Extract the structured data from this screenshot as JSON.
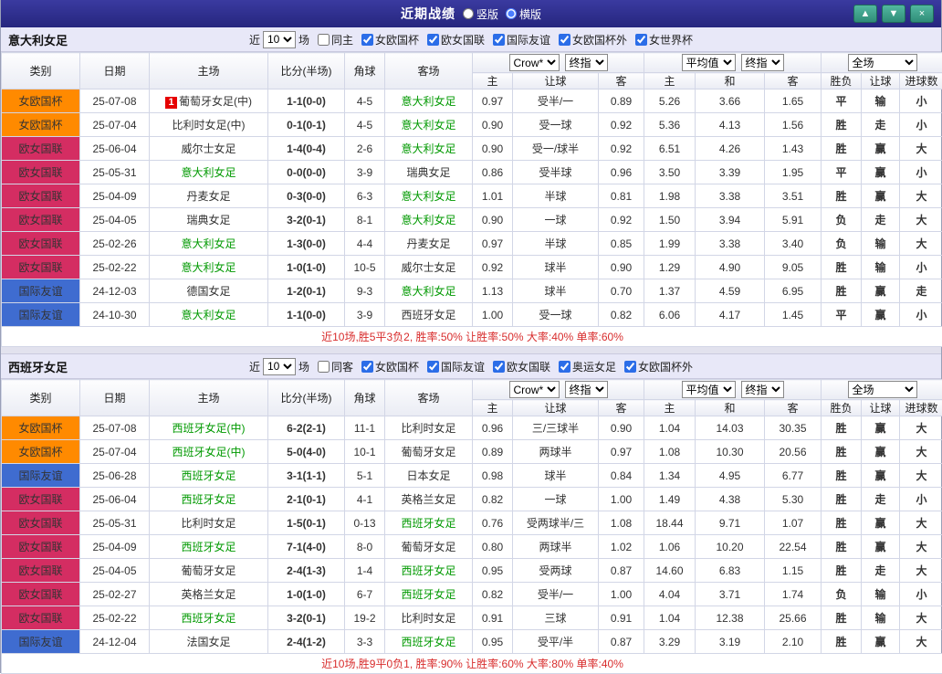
{
  "topbar": {
    "title": "近期战绩",
    "radios": [
      {
        "label": "竖版",
        "selected": false
      },
      {
        "label": "横版",
        "selected": true
      }
    ],
    "buttons": {
      "up": "▲",
      "down": "▼",
      "close": "×"
    }
  },
  "table_header": {
    "static_cols": [
      "类别",
      "日期",
      "主场",
      "比分(半场)",
      "角球",
      "客场"
    ],
    "odds_group1_selects": [
      "Crow*",
      "终指"
    ],
    "odds_group1_sub": [
      "主",
      "让球",
      "客"
    ],
    "odds_group2_selects": [
      "平均值",
      "终指"
    ],
    "odds_group2_sub": [
      "主",
      "和",
      "客"
    ],
    "result_select": "全场",
    "result_sub": [
      "胜负",
      "让球",
      "进球数"
    ]
  },
  "league_colors": {
    "女欧国杯": "#ff8a00",
    "欧女国联": "#d42d62",
    "国际友谊": "#3f6cd0"
  },
  "result_colors": {
    "r": "#e23333",
    "g": "#17a05c",
    "b": "#3156d0"
  },
  "sections": [
    {
      "team": "意大利女足",
      "filter": {
        "near_label": "近",
        "count": "10",
        "games_label": "场",
        "checkboxes": [
          {
            "label": "同主",
            "checked": false
          },
          {
            "label": "女欧国杯",
            "checked": true
          },
          {
            "label": "欧女国联",
            "checked": true
          },
          {
            "label": "国际友谊",
            "checked": true
          },
          {
            "label": "女欧国杯外",
            "checked": true
          },
          {
            "label": "女世界杯",
            "checked": true
          }
        ]
      },
      "rows": [
        {
          "league": "女欧国杯",
          "date": "25-07-08",
          "badge": "1",
          "home": "葡萄牙女足(中)",
          "home_hl": false,
          "score": "1-1(0-0)",
          "corner": "4-5",
          "away": "意大利女足",
          "away_hl": true,
          "odds": [
            "0.97",
            "受半/一",
            "0.89"
          ],
          "avg": [
            "5.26",
            "3.66",
            "1.65"
          ],
          "results": [
            [
              "平",
              "g"
            ],
            [
              "输",
              "b"
            ],
            [
              "小",
              "b"
            ]
          ]
        },
        {
          "league": "女欧国杯",
          "date": "25-07-04",
          "home": "比利时女足(中)",
          "home_hl": false,
          "score": "0-1(0-1)",
          "corner": "4-5",
          "away": "意大利女足",
          "away_hl": true,
          "odds": [
            "0.90",
            "受一球",
            "0.92"
          ],
          "avg": [
            "5.36",
            "4.13",
            "1.56"
          ],
          "results": [
            [
              "胜",
              "r"
            ],
            [
              "走",
              "g"
            ],
            [
              "小",
              "b"
            ]
          ]
        },
        {
          "league": "欧女国联",
          "date": "25-06-04",
          "home": "威尔士女足",
          "home_hl": false,
          "score": "1-4(0-4)",
          "corner": "2-6",
          "away": "意大利女足",
          "away_hl": true,
          "odds": [
            "0.90",
            "受一/球半",
            "0.92"
          ],
          "avg": [
            "6.51",
            "4.26",
            "1.43"
          ],
          "results": [
            [
              "胜",
              "r"
            ],
            [
              "赢",
              "r"
            ],
            [
              "大",
              "r"
            ]
          ]
        },
        {
          "league": "欧女国联",
          "date": "25-05-31",
          "home": "意大利女足",
          "home_hl": true,
          "score": "0-0(0-0)",
          "corner": "3-9",
          "away": "瑞典女足",
          "away_hl": false,
          "odds": [
            "0.86",
            "受半球",
            "0.96"
          ],
          "avg": [
            "3.50",
            "3.39",
            "1.95"
          ],
          "results": [
            [
              "平",
              "g"
            ],
            [
              "赢",
              "r"
            ],
            [
              "小",
              "b"
            ]
          ]
        },
        {
          "league": "欧女国联",
          "date": "25-04-09",
          "home": "丹麦女足",
          "home_hl": false,
          "score": "0-3(0-0)",
          "corner": "6-3",
          "away": "意大利女足",
          "away_hl": true,
          "odds": [
            "1.01",
            "半球",
            "0.81"
          ],
          "avg": [
            "1.98",
            "3.38",
            "3.51"
          ],
          "results": [
            [
              "胜",
              "r"
            ],
            [
              "赢",
              "r"
            ],
            [
              "大",
              "r"
            ]
          ]
        },
        {
          "league": "欧女国联",
          "date": "25-04-05",
          "home": "瑞典女足",
          "home_hl": false,
          "score": "3-2(0-1)",
          "corner": "8-1",
          "away": "意大利女足",
          "away_hl": true,
          "odds": [
            "0.90",
            "一球",
            "0.92"
          ],
          "avg": [
            "1.50",
            "3.94",
            "5.91"
          ],
          "results": [
            [
              "负",
              "g"
            ],
            [
              "走",
              "g"
            ],
            [
              "大",
              "r"
            ]
          ]
        },
        {
          "league": "欧女国联",
          "date": "25-02-26",
          "home": "意大利女足",
          "home_hl": true,
          "score": "1-3(0-0)",
          "corner": "4-4",
          "away": "丹麦女足",
          "away_hl": false,
          "odds": [
            "0.97",
            "半球",
            "0.85"
          ],
          "avg": [
            "1.99",
            "3.38",
            "3.40"
          ],
          "results": [
            [
              "负",
              "g"
            ],
            [
              "输",
              "b"
            ],
            [
              "大",
              "r"
            ]
          ]
        },
        {
          "league": "欧女国联",
          "date": "25-02-22",
          "home": "意大利女足",
          "home_hl": true,
          "score": "1-0(1-0)",
          "corner": "10-5",
          "away": "威尔士女足",
          "away_hl": false,
          "odds": [
            "0.92",
            "球半",
            "0.90"
          ],
          "avg": [
            "1.29",
            "4.90",
            "9.05"
          ],
          "results": [
            [
              "胜",
              "r"
            ],
            [
              "输",
              "b"
            ],
            [
              "小",
              "b"
            ]
          ]
        },
        {
          "league": "国际友谊",
          "date": "24-12-03",
          "home": "德国女足",
          "home_hl": false,
          "score": "1-2(0-1)",
          "corner": "9-3",
          "away": "意大利女足",
          "away_hl": true,
          "odds": [
            "1.13",
            "球半",
            "0.70"
          ],
          "avg": [
            "1.37",
            "4.59",
            "6.95"
          ],
          "results": [
            [
              "胜",
              "r"
            ],
            [
              "赢",
              "r"
            ],
            [
              "走",
              "g"
            ]
          ]
        },
        {
          "league": "国际友谊",
          "date": "24-10-30",
          "home": "意大利女足",
          "home_hl": true,
          "score": "1-1(0-0)",
          "corner": "3-9",
          "away": "西班牙女足",
          "away_hl": false,
          "odds": [
            "1.00",
            "受一球",
            "0.82"
          ],
          "avg": [
            "6.06",
            "4.17",
            "1.45"
          ],
          "results": [
            [
              "平",
              "g"
            ],
            [
              "赢",
              "r"
            ],
            [
              "小",
              "b"
            ]
          ]
        }
      ],
      "summary": "近10场,胜5平3负2, 胜率:50% 让胜率:50% 大率:40% 单率:60%"
    },
    {
      "team": "西班牙女足",
      "filter": {
        "near_label": "近",
        "count": "10",
        "games_label": "场",
        "checkboxes": [
          {
            "label": "同客",
            "checked": false
          },
          {
            "label": "女欧国杯",
            "checked": true
          },
          {
            "label": "国际友谊",
            "checked": true
          },
          {
            "label": "欧女国联",
            "checked": true
          },
          {
            "label": "奥运女足",
            "checked": true
          },
          {
            "label": "女欧国杯外",
            "checked": true
          }
        ]
      },
      "rows": [
        {
          "league": "女欧国杯",
          "date": "25-07-08",
          "home": "西班牙女足(中)",
          "home_hl": true,
          "score": "6-2(2-1)",
          "corner": "11-1",
          "away": "比利时女足",
          "away_hl": false,
          "odds": [
            "0.96",
            "三/三球半",
            "0.90"
          ],
          "avg": [
            "1.04",
            "14.03",
            "30.35"
          ],
          "results": [
            [
              "胜",
              "r"
            ],
            [
              "赢",
              "r"
            ],
            [
              "大",
              "r"
            ]
          ]
        },
        {
          "league": "女欧国杯",
          "date": "25-07-04",
          "home": "西班牙女足(中)",
          "home_hl": true,
          "score": "5-0(4-0)",
          "corner": "10-1",
          "away": "葡萄牙女足",
          "away_hl": false,
          "odds": [
            "0.89",
            "两球半",
            "0.97"
          ],
          "avg": [
            "1.08",
            "10.30",
            "20.56"
          ],
          "results": [
            [
              "胜",
              "r"
            ],
            [
              "赢",
              "r"
            ],
            [
              "大",
              "r"
            ]
          ]
        },
        {
          "league": "国际友谊",
          "date": "25-06-28",
          "home": "西班牙女足",
          "home_hl": true,
          "score": "3-1(1-1)",
          "corner": "5-1",
          "away": "日本女足",
          "away_hl": false,
          "odds": [
            "0.98",
            "球半",
            "0.84"
          ],
          "avg": [
            "1.34",
            "4.95",
            "6.77"
          ],
          "results": [
            [
              "胜",
              "r"
            ],
            [
              "赢",
              "r"
            ],
            [
              "大",
              "r"
            ]
          ]
        },
        {
          "league": "欧女国联",
          "date": "25-06-04",
          "home": "西班牙女足",
          "home_hl": true,
          "score": "2-1(0-1)",
          "corner": "4-1",
          "away": "英格兰女足",
          "away_hl": false,
          "odds": [
            "0.82",
            "一球",
            "1.00"
          ],
          "avg": [
            "1.49",
            "4.38",
            "5.30"
          ],
          "results": [
            [
              "胜",
              "r"
            ],
            [
              "走",
              "g"
            ],
            [
              "小",
              "b"
            ]
          ]
        },
        {
          "league": "欧女国联",
          "date": "25-05-31",
          "home": "比利时女足",
          "home_hl": false,
          "score": "1-5(0-1)",
          "corner": "0-13",
          "away": "西班牙女足",
          "away_hl": true,
          "odds": [
            "0.76",
            "受两球半/三",
            "1.08"
          ],
          "avg": [
            "18.44",
            "9.71",
            "1.07"
          ],
          "results": [
            [
              "胜",
              "r"
            ],
            [
              "赢",
              "r"
            ],
            [
              "大",
              "r"
            ]
          ]
        },
        {
          "league": "欧女国联",
          "date": "25-04-09",
          "home": "西班牙女足",
          "home_hl": true,
          "score": "7-1(4-0)",
          "corner": "8-0",
          "away": "葡萄牙女足",
          "away_hl": false,
          "odds": [
            "0.80",
            "两球半",
            "1.02"
          ],
          "avg": [
            "1.06",
            "10.20",
            "22.54"
          ],
          "results": [
            [
              "胜",
              "r"
            ],
            [
              "赢",
              "r"
            ],
            [
              "大",
              "r"
            ]
          ]
        },
        {
          "league": "欧女国联",
          "date": "25-04-05",
          "home": "葡萄牙女足",
          "home_hl": false,
          "score": "2-4(1-3)",
          "corner": "1-4",
          "away": "西班牙女足",
          "away_hl": true,
          "odds": [
            "0.95",
            "受两球",
            "0.87"
          ],
          "avg": [
            "14.60",
            "6.83",
            "1.15"
          ],
          "results": [
            [
              "胜",
              "r"
            ],
            [
              "走",
              "g"
            ],
            [
              "大",
              "r"
            ]
          ]
        },
        {
          "league": "欧女国联",
          "date": "25-02-27",
          "home": "英格兰女足",
          "home_hl": false,
          "score": "1-0(1-0)",
          "corner": "6-7",
          "away": "西班牙女足",
          "away_hl": true,
          "odds": [
            "0.82",
            "受半/一",
            "1.00"
          ],
          "avg": [
            "4.04",
            "3.71",
            "1.74"
          ],
          "results": [
            [
              "负",
              "g"
            ],
            [
              "输",
              "b"
            ],
            [
              "小",
              "b"
            ]
          ]
        },
        {
          "league": "欧女国联",
          "date": "25-02-22",
          "home": "西班牙女足",
          "home_hl": true,
          "score": "3-2(0-1)",
          "corner": "19-2",
          "away": "比利时女足",
          "away_hl": false,
          "odds": [
            "0.91",
            "三球",
            "0.91"
          ],
          "avg": [
            "1.04",
            "12.38",
            "25.66"
          ],
          "results": [
            [
              "胜",
              "r"
            ],
            [
              "输",
              "b"
            ],
            [
              "大",
              "r"
            ]
          ]
        },
        {
          "league": "国际友谊",
          "date": "24-12-04",
          "home": "法国女足",
          "home_hl": false,
          "score": "2-4(1-2)",
          "corner": "3-3",
          "away": "西班牙女足",
          "away_hl": true,
          "odds": [
            "0.95",
            "受平/半",
            "0.87"
          ],
          "avg": [
            "3.29",
            "3.19",
            "2.10"
          ],
          "results": [
            [
              "胜",
              "r"
            ],
            [
              "赢",
              "r"
            ],
            [
              "大",
              "r"
            ]
          ]
        }
      ],
      "summary": "近10场,胜9平0负1, 胜率:90% 让胜率:60% 大率:80% 单率:40%"
    }
  ]
}
